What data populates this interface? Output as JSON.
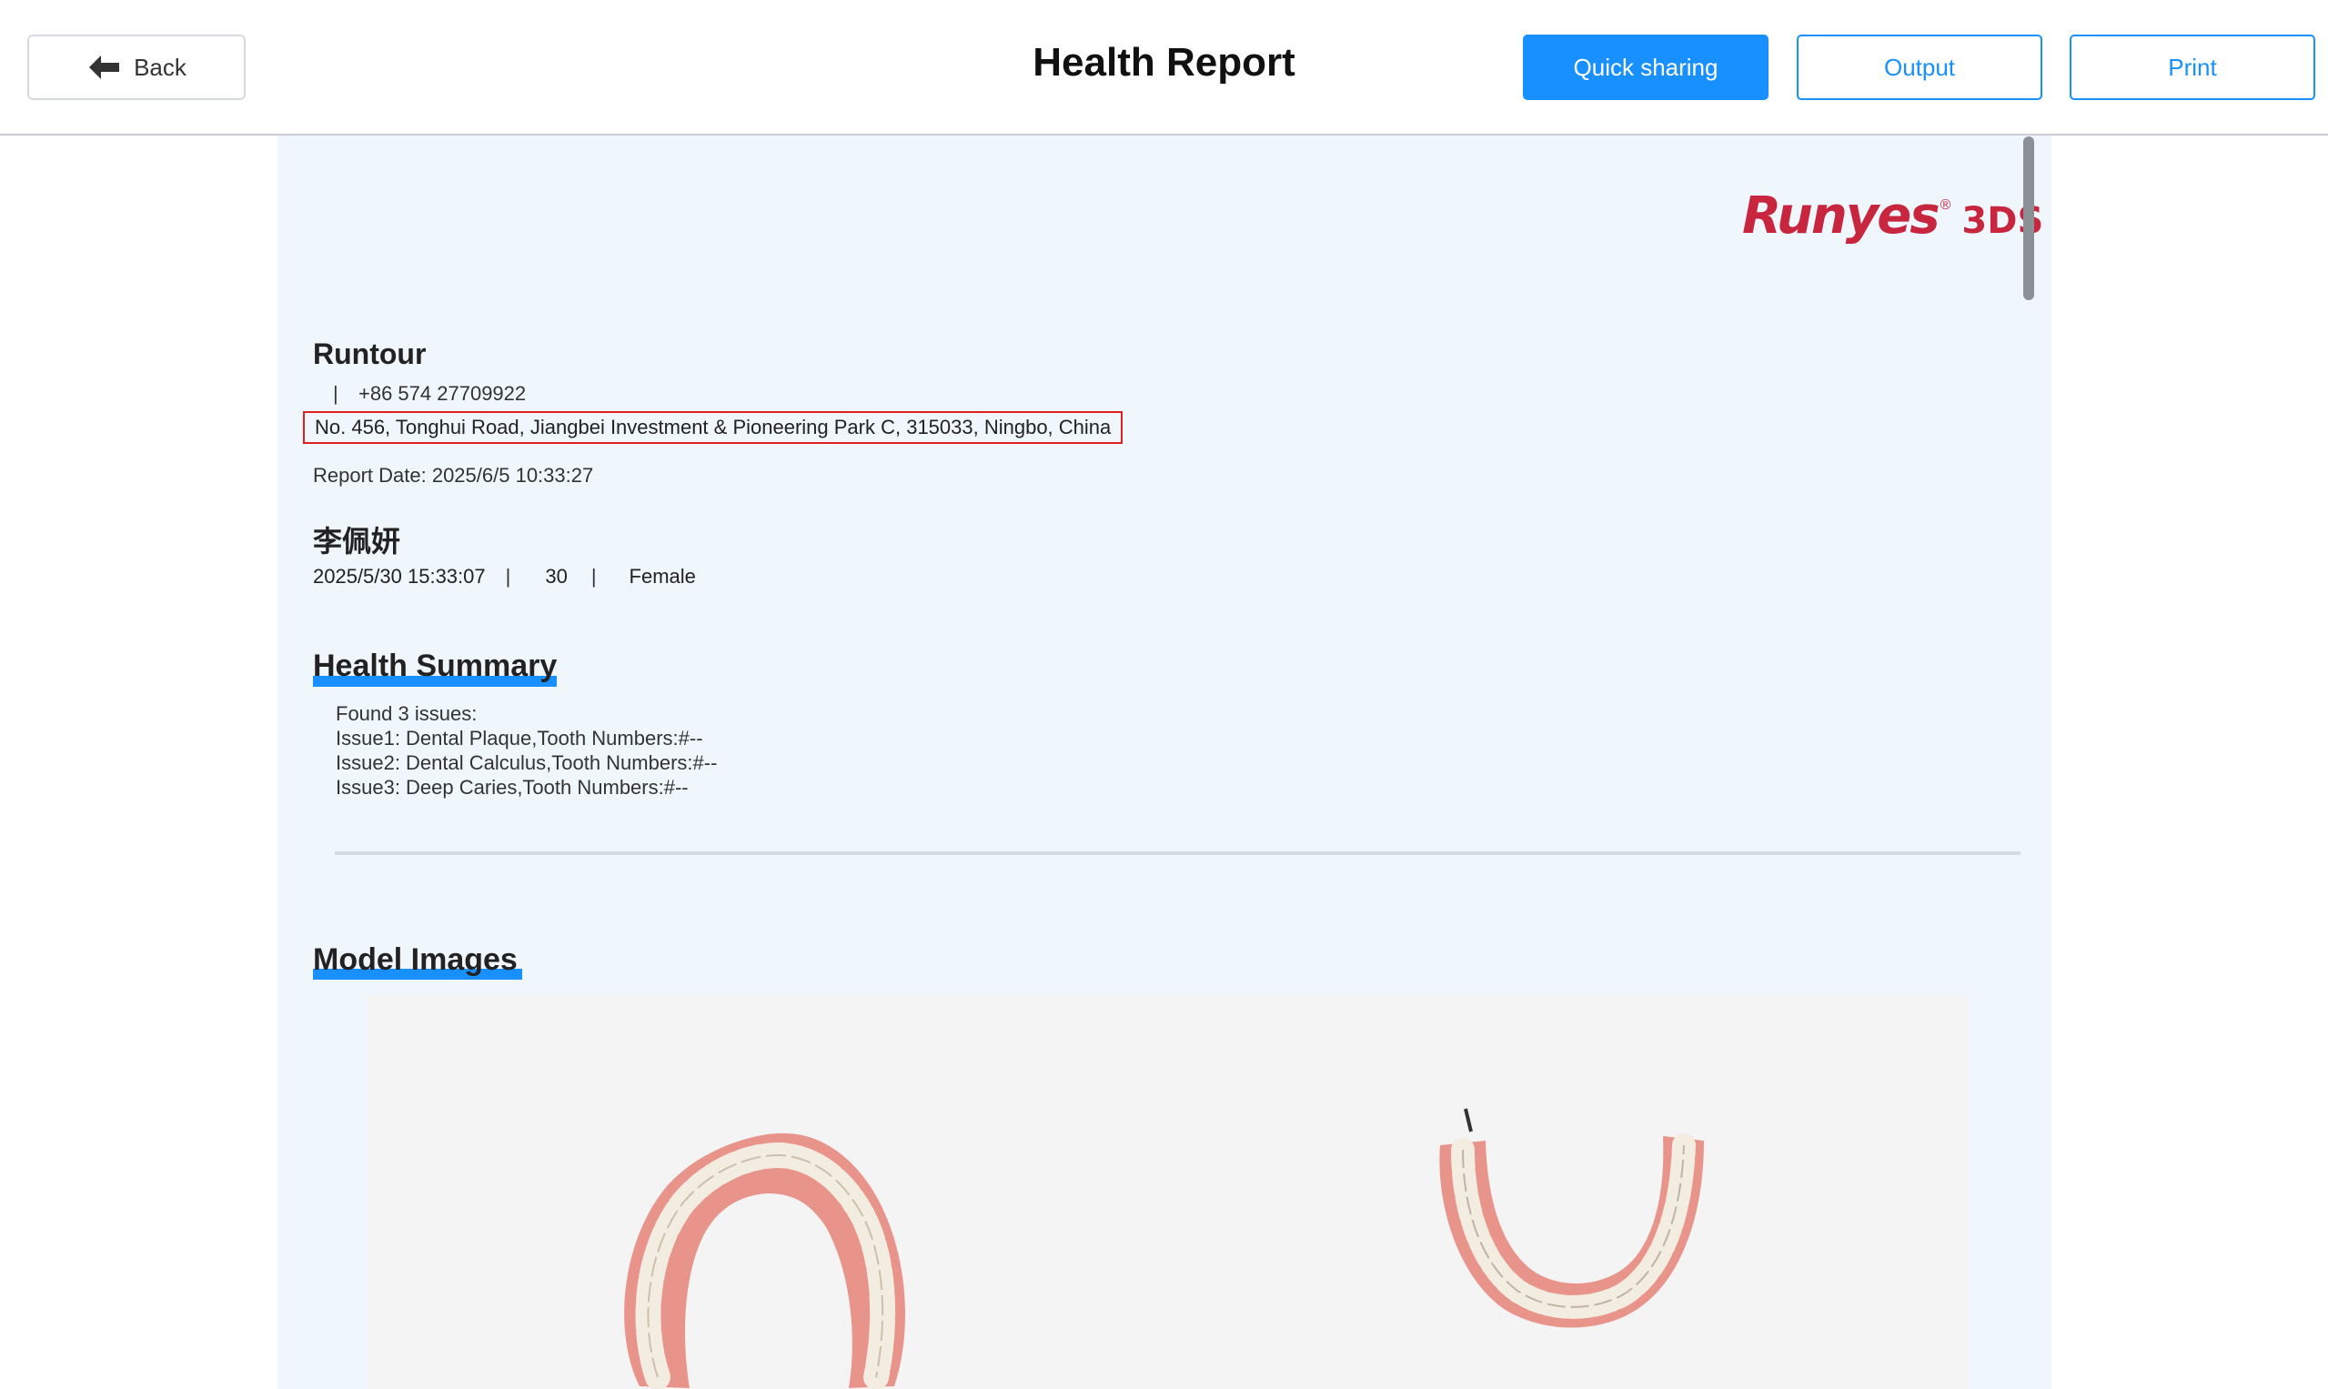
{
  "header": {
    "back_label": "Back",
    "title": "Health Report",
    "quick_sharing_label": "Quick sharing",
    "output_label": "Output",
    "print_label": "Print"
  },
  "report": {
    "logo": {
      "main": "Runyes",
      "registered": "®",
      "sub": "3DS"
    },
    "clinic": {
      "name": "Runtour",
      "phone_separator": "|",
      "phone": "+86 574 27709922",
      "address": "No. 456, Tonghui Road, Jiangbei Investment & Pioneering Park C, 315033, Ningbo, China"
    },
    "report_date": "Report Date: 2025/6/5 10:33:27",
    "patient": {
      "name": "李佩妍",
      "scan_time": "2025/5/30 15:33:07",
      "separator": "|",
      "age": "30",
      "gender": "Female"
    },
    "health_summary": {
      "title": "Health Summary",
      "lines": [
        "Found 3 issues:",
        "Issue1: Dental Plaque,Tooth Numbers:#--",
        "Issue2: Dental Calculus,Tooth Numbers:#--",
        "Issue3: Deep Caries,Tooth Numbers:#--"
      ]
    },
    "model_images": {
      "title": "Model Images"
    }
  },
  "colors": {
    "accent": "#1890ff",
    "report_background": "#eff6fc",
    "logo_red": "#c8263f",
    "highlight_box": "#e02020"
  }
}
